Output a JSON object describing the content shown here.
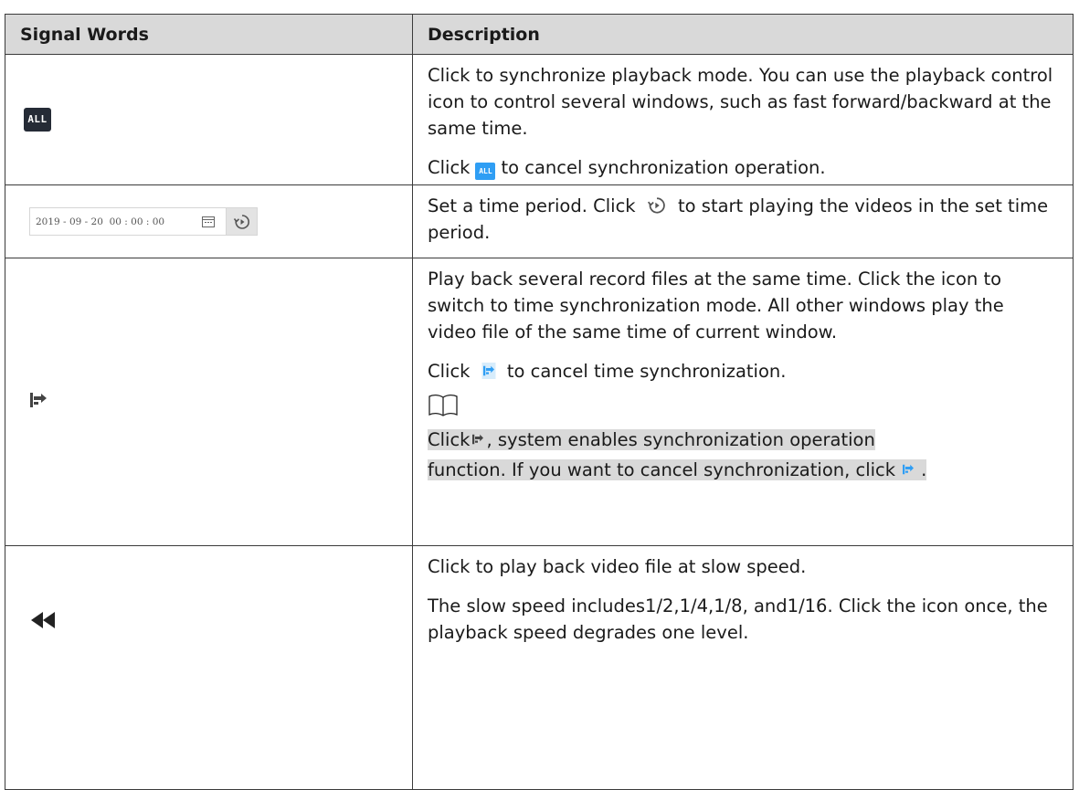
{
  "table": {
    "headers": {
      "col1": "Signal Words",
      "col2": "Description"
    },
    "rows": [
      {
        "icon": "all-sync-button",
        "icon_text": "ALL",
        "paragraphs": [
          "Click to synchronize playback mode. You can use the playback control icon to control several windows, such as fast forward/backward at the same time."
        ],
        "cancel_prefix": "Click",
        "cancel_suffix": "to cancel synchronization operation."
      },
      {
        "icon": "date-time-picker",
        "date_value": "2019 - 09 - 20  00 : 00 : 00",
        "desc_prefix": "Set a time period. Click",
        "desc_suffix": "to start playing the videos in the set time period."
      },
      {
        "icon": "time-sync-icon",
        "paragraphs": [
          "Play back several record files at the same time. Click the icon to switch to time synchronization mode. All other windows play the video file of the same time of current window."
        ],
        "cancel_prefix": "Click",
        "cancel_suffix": "to cancel time synchronization.",
        "note_line1_prefix": "Click",
        "note_line1_suffix": ", system enables synchronization operation",
        "note_line2_prefix": "function. If you want to cancel synchronization, click",
        "note_line2_suffix": "."
      },
      {
        "icon": "slow-play-icon",
        "paragraphs": [
          "Click to play back video file at slow speed.",
          "The slow speed includes1/2,1/4,1/8, and1/16. Click the icon once, the playback speed degrades one level."
        ]
      }
    ]
  },
  "colors": {
    "header_bg": "#d9d9d9",
    "border": "#3b3b3b",
    "accent_blue": "#2f9ef4",
    "dark_button": "#252b36"
  }
}
